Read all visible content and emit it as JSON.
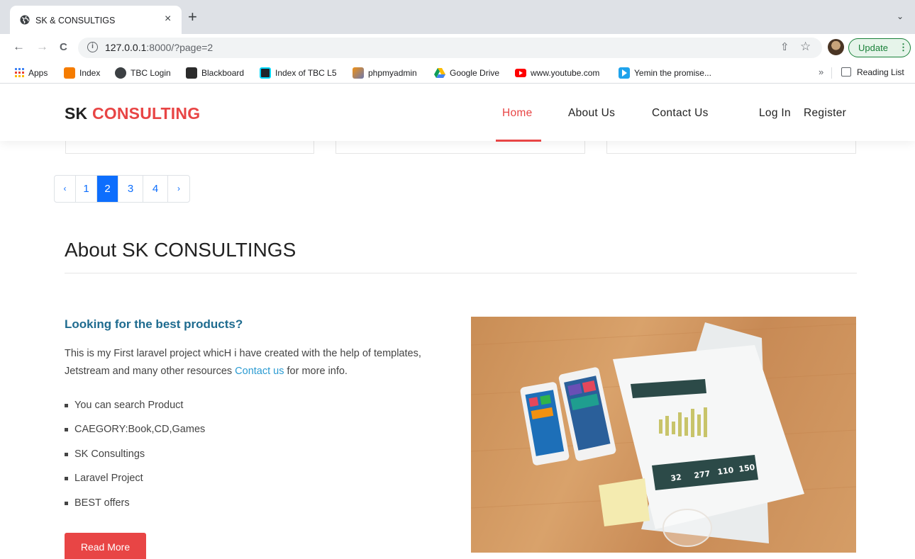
{
  "browser": {
    "tab_title": "SK & CONSULTIGS",
    "tab_close": "×",
    "new_tab": "+",
    "tab_search": "⌄",
    "url_host": "127.0.0.1",
    "url_rest": ":8000/?page=2",
    "back": "←",
    "forward": "→",
    "reload": "C",
    "share_icon": "⇧",
    "star_icon": "☆",
    "update_label": "Update",
    "update_menu": "⋮",
    "bookmarks": [
      {
        "label": "Apps",
        "color": "#4285f4"
      },
      {
        "label": "Index",
        "color": "#f57c00"
      },
      {
        "label": "TBC Login",
        "color": "#3c4043"
      },
      {
        "label": "Blackboard",
        "color": "#2b2b2b"
      },
      {
        "label": "Index of TBC L5",
        "color": "#00d8ff"
      },
      {
        "label": "phpmyadmin",
        "color": "#f29111"
      },
      {
        "label": "Google Drive",
        "color": "#0f9d58"
      },
      {
        "label": "www.youtube.com",
        "color": "#ff0000"
      },
      {
        "label": "Yemin the promise...",
        "color": "#1fa3ec"
      }
    ],
    "bookmarks_more": "»",
    "reading_list": "Reading List"
  },
  "site": {
    "logo_sk": "SK",
    "logo_consulting": "CONSULTING",
    "nav": {
      "home": "Home",
      "about": "About Us",
      "contact": "Contact Us",
      "login": "Log In",
      "register": "Register"
    },
    "accent_color": "#e84545"
  },
  "pagination": {
    "prev": "‹",
    "pages": [
      "1",
      "2",
      "3",
      "4"
    ],
    "current": "2",
    "next": "›"
  },
  "about": {
    "title": "About SK CONSULTINGS",
    "subheading": "Looking for the best products?",
    "paragraph_before": "This is my First laravel project whicH i have created with the help of templates, Jetstream and many other resources ",
    "paragraph_link": "Contact us",
    "paragraph_after": " for more info.",
    "features": [
      "You can search Product",
      "CAEGORY:Book,CD,Games",
      "SK Consultings",
      "Laravel Project",
      "BEST offers"
    ],
    "read_more": "Read More"
  },
  "hero_image": {
    "stat_labels": [
      "32",
      "277",
      "110",
      "150"
    ]
  }
}
